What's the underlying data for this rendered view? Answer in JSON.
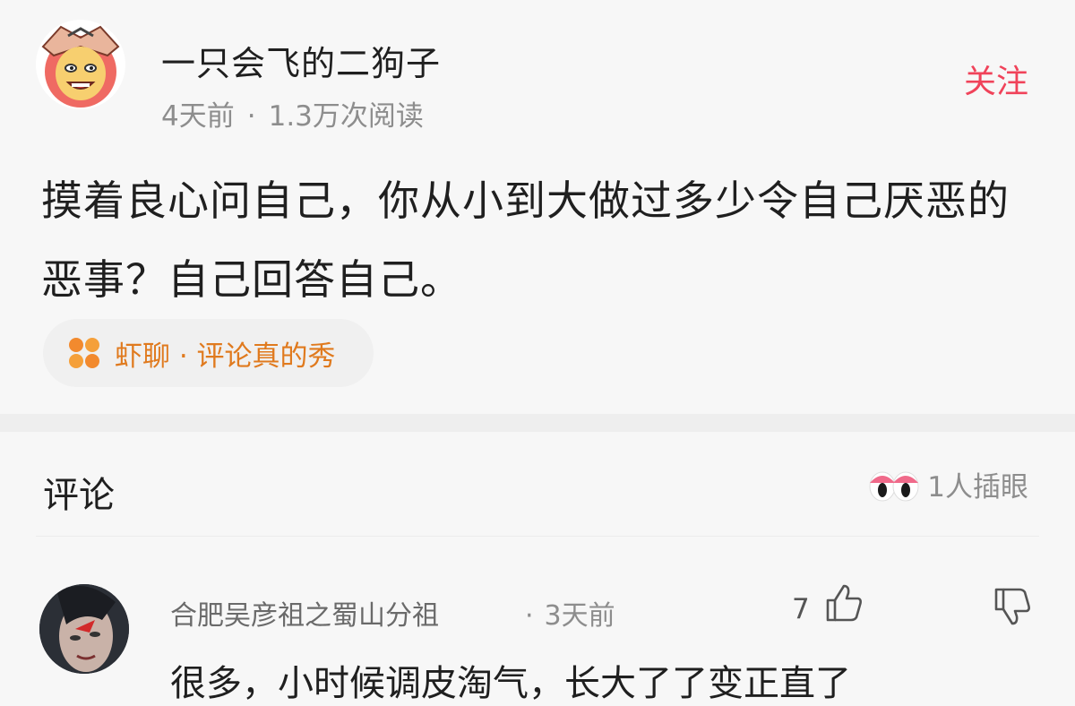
{
  "post": {
    "author_name": "一只会飞的二狗子",
    "time_ago": "4天前",
    "dot": "·",
    "read_count": "1.3万次阅读",
    "follow_label": "关注",
    "text": "摸着良心问自己，你从小到大做过多少令自己厌恶的恶事？自己回答自己。",
    "topic_label": "虾聊 · 评论真的秀"
  },
  "comments": {
    "title": "评论",
    "eyes_count": "1人插眼",
    "items": [
      {
        "user": "合肥吴彦祖之蜀山分祖",
        "dot": "·",
        "time_ago": "3天前",
        "likes": "7",
        "text": "很多，小时候调皮淘气，长大了了变正直了"
      }
    ]
  },
  "colors": {
    "accent": "#f0435a",
    "topic": "#e07a1e",
    "muted": "#8d8d8d"
  },
  "icons": {
    "topic": "four-petal-flower-icon",
    "eyes": "peeking-eyes-icon",
    "like": "thumbs-up-icon",
    "dislike": "thumbs-down-icon"
  }
}
